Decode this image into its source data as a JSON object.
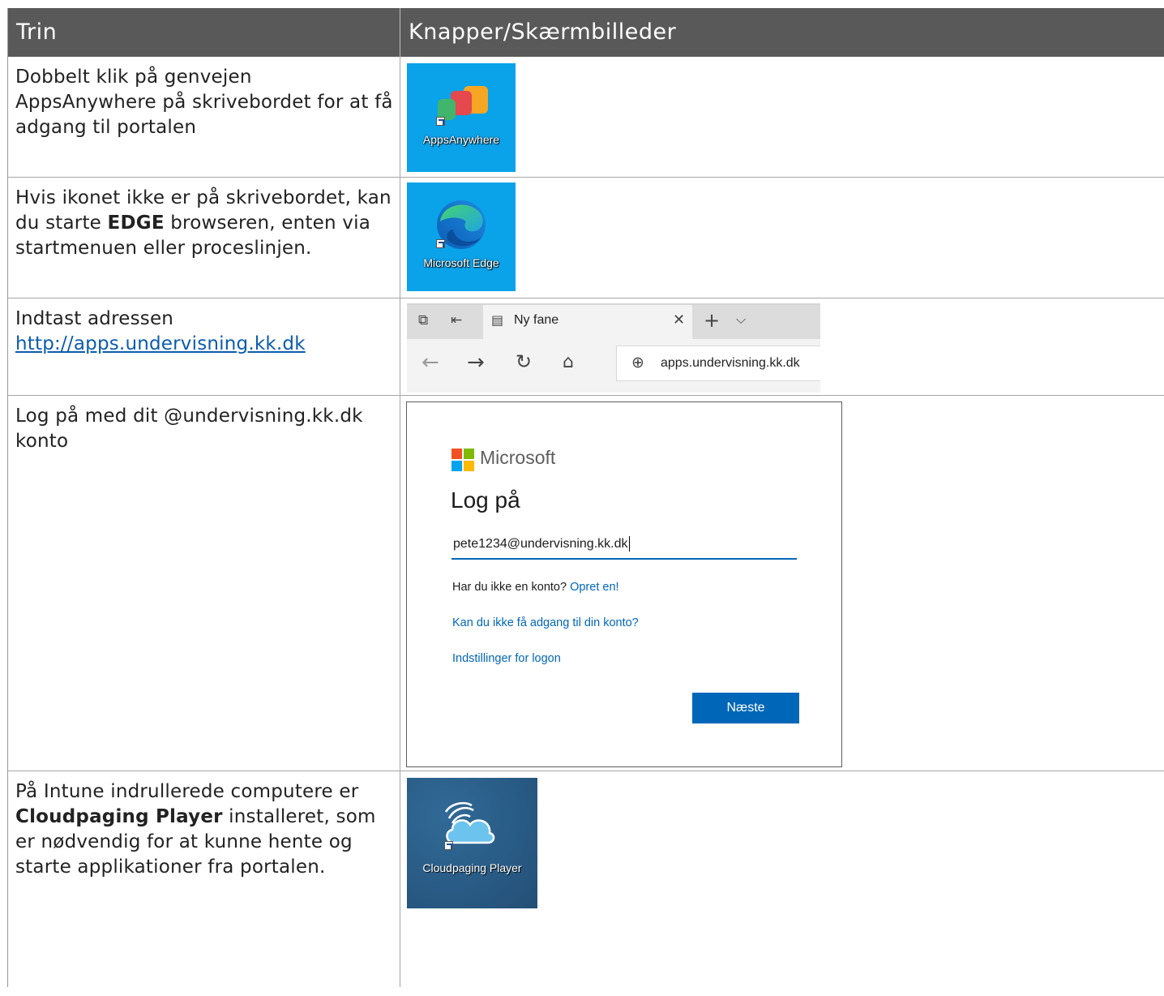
{
  "header": {
    "col1": "Trin",
    "col2": "Knapper/Skærmbilleder"
  },
  "rows": [
    {
      "text": "Dobbelt klik på genvejen AppsAnywhere på skrivebordet for at få adgang til portalen",
      "icon_label": "AppsAnywhere"
    },
    {
      "text_before": "Hvis ikonet ikke er på skrivebordet, kan du starte ",
      "bold": "EDGE",
      "text_after": " browseren, enten via startmenuen eller proceslinjen.",
      "icon_label": "Microsoft Edge"
    },
    {
      "text": "Indtast adressen",
      "link": "http://apps.undervisning.kk.dk",
      "tab_title": "Ny fane",
      "address": "apps.undervisning.kk.dk"
    },
    {
      "text": "Log på med dit @undervisning.kk.dk konto",
      "login": {
        "brand": "Microsoft",
        "title": "Log på",
        "email": "pete1234@undervisning.kk.dk",
        "no_account": "Har du ikke en konto?",
        "create": "Opret en!",
        "no_access": "Kan du ikke få adgang til din konto?",
        "options": "Indstillinger for logon",
        "next": "Næste"
      }
    },
    {
      "text_before": "På Intune indrullerede computere er ",
      "bold": "Cloudpaging Player",
      "text_after": " installeret, som er nødvendig for at kunne hente og starte applikationer fra portalen.",
      "icon_label": "Cloudpaging Player"
    }
  ],
  "colors": {
    "header_bg": "#595959",
    "link": "#0b5cad",
    "ms_blue": "#0067b8",
    "desktop_blue": "#0aa3ea"
  }
}
